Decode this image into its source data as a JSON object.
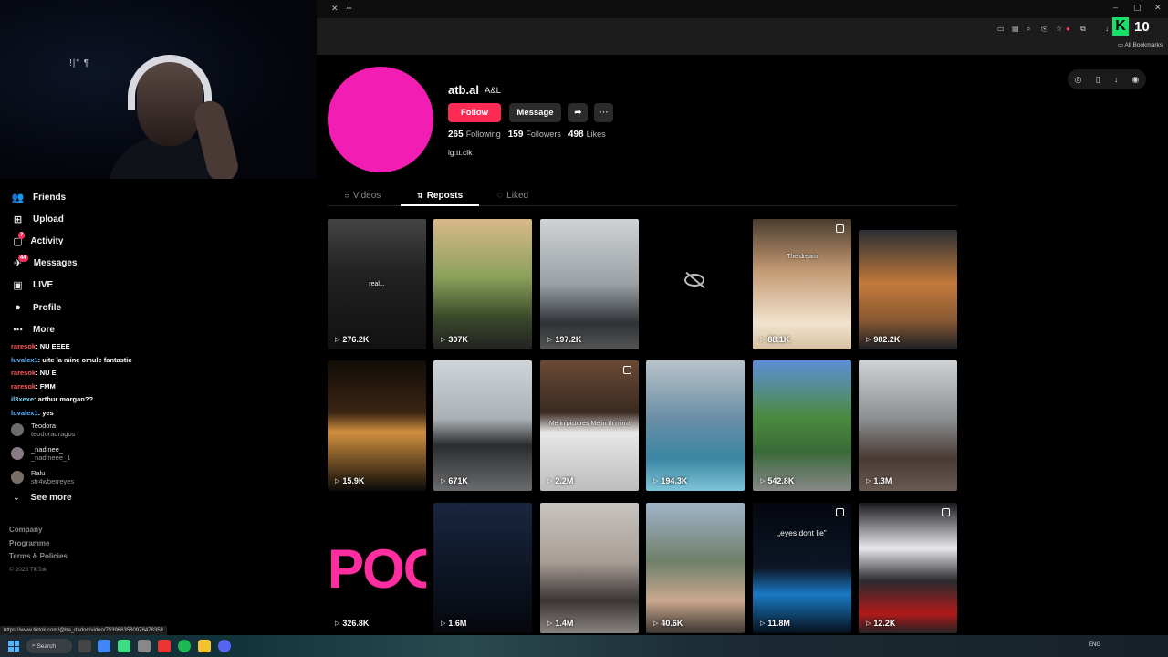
{
  "webcam": {
    "overlay_text": "!|\" ¶"
  },
  "sidebar": {
    "nav": [
      {
        "label": "Friends",
        "icon": "friends-icon",
        "glyph": "👥"
      },
      {
        "label": "Upload",
        "icon": "upload-icon",
        "glyph": "⊞"
      },
      {
        "label": "Activity",
        "icon": "activity-icon",
        "glyph": "▢",
        "badge": "7"
      },
      {
        "label": "Messages",
        "icon": "messages-icon",
        "glyph": "✈",
        "badge": "44"
      },
      {
        "label": "LIVE",
        "icon": "live-icon",
        "glyph": "▣"
      },
      {
        "label": "Profile",
        "icon": "profile-icon",
        "glyph": "●"
      },
      {
        "label": "More",
        "icon": "more-icon",
        "glyph": "⋯"
      }
    ],
    "chat": [
      {
        "user": "raresok",
        "msg": ": NU EEEE"
      },
      {
        "user": "luvalex1",
        "msg": ": uite la mine omule fantastic"
      },
      {
        "user": "raresok",
        "msg": ": NU E"
      },
      {
        "user": "raresok",
        "msg": ": FMM"
      },
      {
        "user": "il3xexe",
        "msg": ": arthur morgan??"
      },
      {
        "user": "luvalex1",
        "msg": ": yes"
      }
    ],
    "following": [
      {
        "name": "Teodora",
        "handle": "teodoradragos"
      },
      {
        "name": "_nadinee_",
        "handle": "_nadineee_1"
      },
      {
        "name": "Ralu",
        "handle": "str4wberreyes"
      }
    ],
    "see_more": "See more",
    "footer": {
      "company": "Company",
      "programme": "Programme",
      "terms": "Terms & Policies",
      "copyright": "© 2025 TikTok"
    }
  },
  "browser": {
    "bookmarks": "All Bookmarks",
    "logo_number": "10",
    "status_url": "https://www.tiktok.com/@ba_dadon/video/7539663580978478358"
  },
  "profile": {
    "username": "atb.al",
    "nickname": "A&L",
    "follow_label": "Follow",
    "message_label": "Message",
    "following_count": "265",
    "following_label": "Following",
    "followers_count": "159",
    "followers_label": "Followers",
    "likes_count": "498",
    "likes_label": "Likes",
    "bio": "lg:tt.clk",
    "avatar_color": "#f21eb4",
    "accent_color": "#fe2c55"
  },
  "tabs": [
    {
      "label": "Videos",
      "icon": "grid-icon"
    },
    {
      "label": "Reposts",
      "icon": "repost-icon",
      "active": true
    },
    {
      "label": "Liked",
      "icon": "heart-outline-icon"
    }
  ],
  "videos": [
    {
      "views": "276.2K",
      "caption": "real..."
    },
    {
      "views": "307K"
    },
    {
      "views": "197.2K"
    },
    {
      "hidden": true
    },
    {
      "views": "88.1K",
      "caption": "The dream",
      "multi": true
    },
    {
      "views": "982.2K"
    },
    {
      "views": "15.9K"
    },
    {
      "views": "671K"
    },
    {
      "views": "2.2M",
      "caption": "Me in pictures    Me in th mirro",
      "multi": true
    },
    {
      "views": "194.3K"
    },
    {
      "views": "542.8K"
    },
    {
      "views": "1.3M"
    },
    {
      "views": "326.8K",
      "caption": "POO"
    },
    {
      "views": "1.6M"
    },
    {
      "views": "1.4M"
    },
    {
      "views": "40.6K"
    },
    {
      "views": "11.8M",
      "caption": "„eyes dont lie”",
      "multi": true
    },
    {
      "views": "12.2K",
      "multi": true
    }
  ],
  "taskbar": {
    "search_label": "Search",
    "lang": "ENG"
  }
}
